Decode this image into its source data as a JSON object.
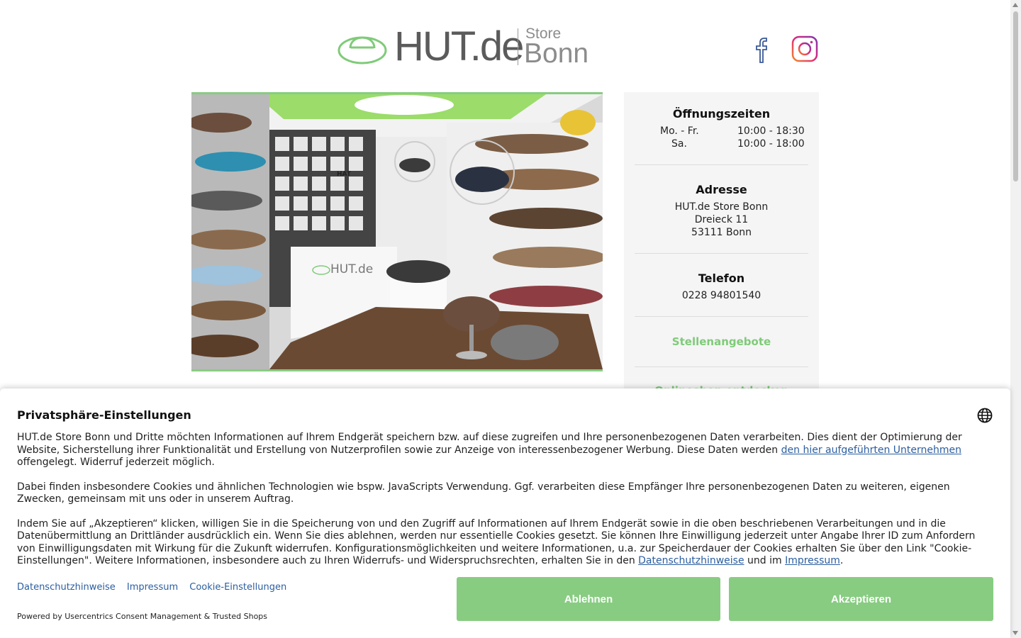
{
  "header": {
    "logo_text": "HUT.de",
    "logo_store": "Store",
    "logo_city": "Bonn",
    "social": [
      {
        "icon": "facebook-icon"
      },
      {
        "icon": "instagram-icon"
      }
    ]
  },
  "colors": {
    "accent_green": "#88cc82",
    "link_green": "#7fcb79",
    "link_blue": "#2b5ea0"
  },
  "store_photo": {
    "sign_text": "HUT.de",
    "wall_sign": "HAT"
  },
  "info": {
    "hours_title": "Öffnungszeiten",
    "hours": [
      {
        "day": "Mo. - Fr.",
        "time": "10:00 - 18:30"
      },
      {
        "day": "Sa.",
        "time": "10:00 - 18:00"
      }
    ],
    "address_title": "Adresse",
    "address_lines": [
      "HUT.de Store Bonn",
      "Dreieck 11",
      "53111 Bonn"
    ],
    "phone_title": "Telefon",
    "phone": "0228 94801540",
    "jobs_link": "Stellenangebote",
    "partial_link": "Onlineshop entdecken"
  },
  "consent": {
    "title": "Privatsphäre-Einstellungen",
    "p1_before": "HUT.de Store Bonn und Dritte möchten Informationen auf Ihrem Endgerät speichern bzw. auf diese zugreifen und Ihre personenbezogenen Daten verarbeiten. Dies dient der Optimierung der Website, Sicherstellung ihrer Funktionalität und Erstellung von Nutzerprofilen sowie zur Anzeige von interessenbezogener Werbung. Diese Daten werden ",
    "p1_link": "den hier aufgeführten Unternehmen",
    "p1_after": " offengelegt. Widerruf jederzeit möglich.",
    "p2": "Dabei finden insbesondere Cookies und ähnlichen Technologien wie bspw. JavaScripts Verwendung. Ggf. verarbeiten diese Empfänger Ihre personenbezogenen Daten zu weiteren, eigenen Zwecken, gemeinsam mit uns oder in unserem Auftrag.",
    "p3_before": "Indem Sie auf „Akzeptieren“ klicken, willigen Sie in die Speicherung von und den Zugriff auf Informationen auf Ihrem Endgerät sowie in die oben beschriebenen Verarbeitungen und in die Datenübermittlung an Drittländer ausdrücklich ein. Wenn Sie dies ablehnen, werden nur essentielle Cookies gesetzt. Sie können Ihre Einwilligung jederzeit unter Angabe Ihrer ID zum Anfordern von Einwilligungsdaten mit Wirkung für die Zukunft widerrufen. Konfigurationsmöglichkeiten und weitere Informationen, u.a. zur Speicherdauer der Cookies erhalten Sie über den Link \"Cookie-Einstellungen\". Weitere Informationen, insbesondere auch zu Ihren Widerrufs- und Widerspruchsrechten, erhalten Sie in den ",
    "p3_link1": "Datenschutzhinweise",
    "p3_mid": " und im ",
    "p3_link2": "Impressum",
    "p3_end": ".",
    "footer_links": [
      "Datenschutzhinweise",
      "Impressum",
      "Cookie-Einstellungen"
    ],
    "powered_by": "Powered by Usercentrics Consent Management & Trusted Shops",
    "deny_label": "Ablehnen",
    "accept_label": "Akzeptieren",
    "language_icon": "globe-icon"
  }
}
